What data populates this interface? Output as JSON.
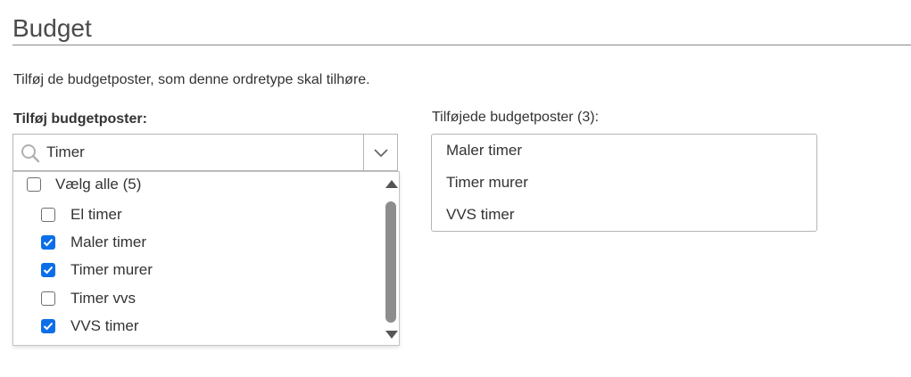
{
  "page": {
    "title": "Budget",
    "description": "Tilføj de budgetposter, som denne ordretype skal tilhøre."
  },
  "add_section": {
    "label": "Tilføj budgetposter:",
    "search_value": "Timer",
    "search_icon": "search-icon",
    "toggle_icon": "chevron-down-icon",
    "select_all": {
      "label": "Vælg alle (5)",
      "checked": false
    },
    "options": [
      {
        "label": "El timer",
        "checked": false
      },
      {
        "label": "Maler timer",
        "checked": true
      },
      {
        "label": "Timer murer",
        "checked": true
      },
      {
        "label": "Timer vvs",
        "checked": false
      },
      {
        "label": "VVS timer",
        "checked": true
      }
    ]
  },
  "added_section": {
    "label": "Tilføjede budgetposter (3):",
    "items": [
      "Maler timer",
      "Timer murer",
      "VVS timer"
    ]
  },
  "colors": {
    "accent": "#0a6fe8",
    "border": "#b5b5b5",
    "rule": "#8a8a8a"
  }
}
